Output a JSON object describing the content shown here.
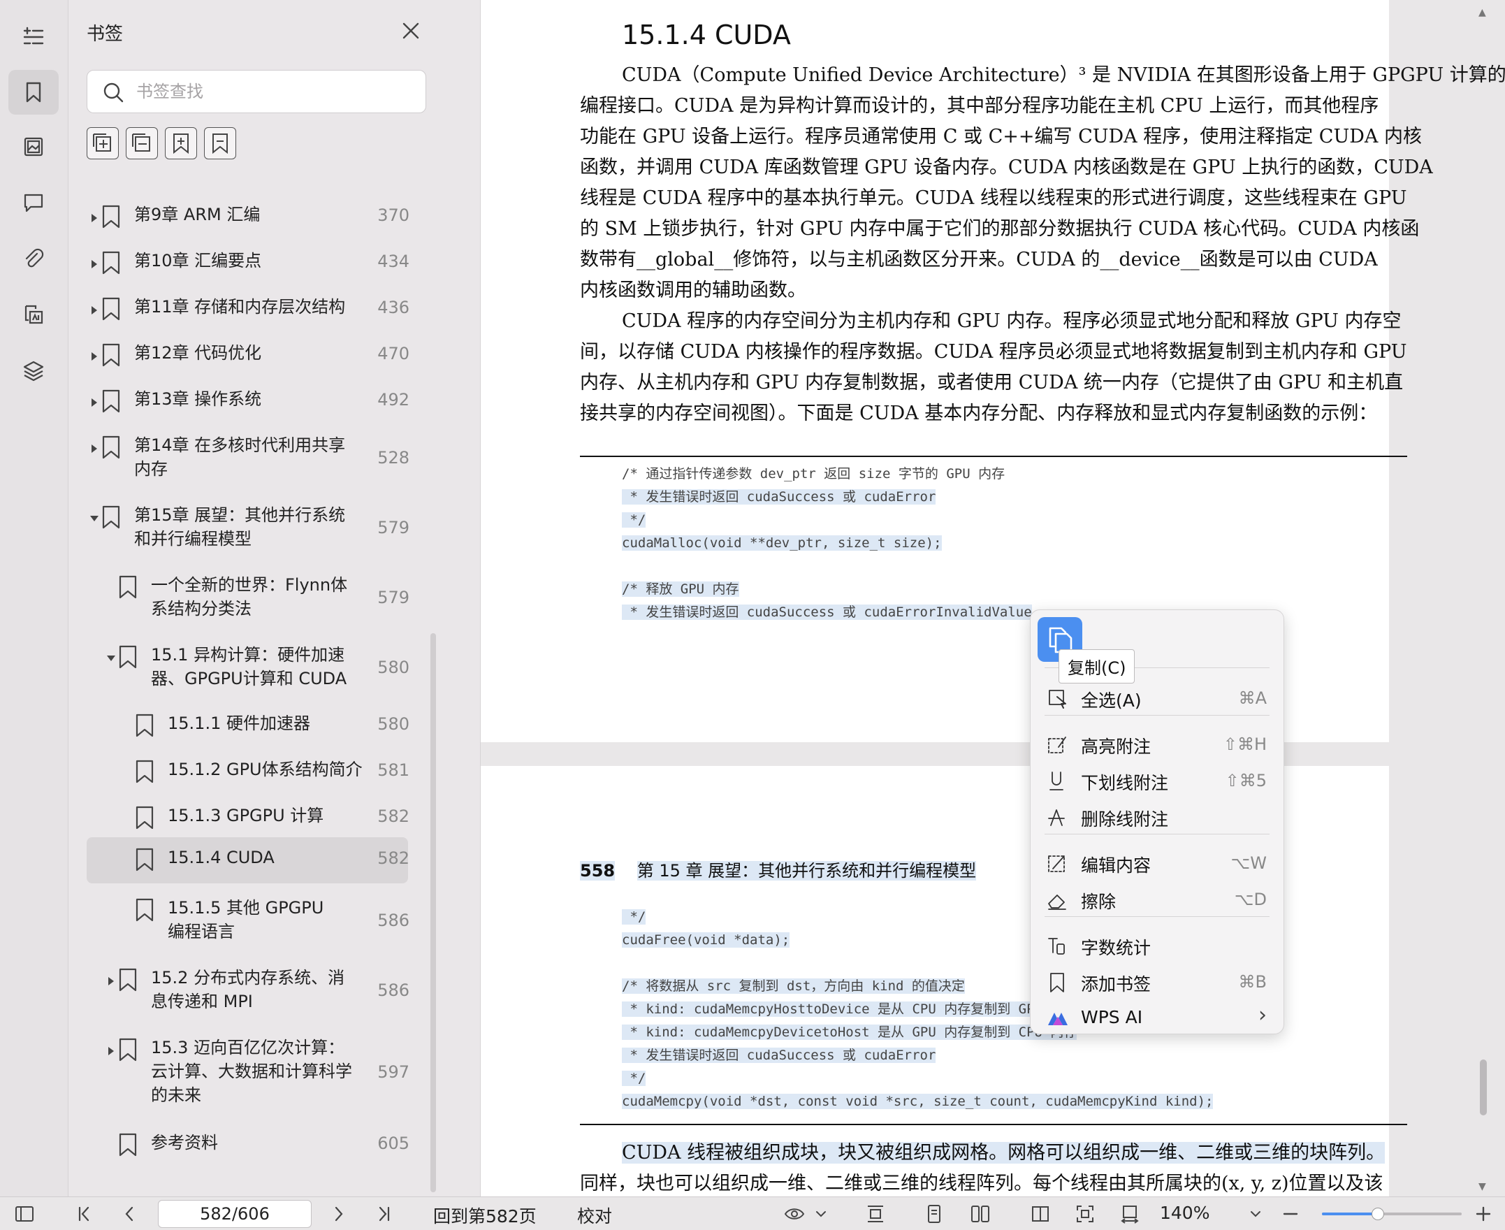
{
  "panel": {
    "title": "书签",
    "search_placeholder": "书签查找",
    "items": [
      {
        "label": "第9章  ARM 汇编",
        "page": "370"
      },
      {
        "label": "第10章  汇编要点",
        "page": "434"
      },
      {
        "label": "第11章  存储和内存层次结构",
        "page": "436"
      },
      {
        "label": "第12章  代码优化",
        "page": "470"
      },
      {
        "label": "第13章  操作系统",
        "page": "492"
      },
      {
        "label_lines": [
          "第14章  在多核时代利用共享",
          "内存"
        ],
        "page": "528"
      },
      {
        "label_lines": [
          "第15章  展望：其他并行系统",
          "和并行编程模型"
        ],
        "page": "579"
      },
      {
        "label_lines": [
          "一个全新的世界：Flynn体",
          "系结构分类法"
        ],
        "page": "579"
      },
      {
        "label_lines": [
          "15.1  异构计算：硬件加速",
          "器、GPGPU计算和 CUDA"
        ],
        "page": "580"
      },
      {
        "label": "15.1.1  硬件加速器",
        "page": "580"
      },
      {
        "label": "15.1.2  GPU体系结构简介",
        "page": "581"
      },
      {
        "label": "15.1.3    GPGPU 计算",
        "page": "582"
      },
      {
        "label": "15.1.4    CUDA",
        "page": "582"
      },
      {
        "label_lines": [
          "15.1.5    其他 GPGPU",
          "编程语言"
        ],
        "page": "586"
      },
      {
        "label_lines": [
          "15.2  分布式内存系统、消",
          "息传递和 MPI"
        ],
        "page": "586"
      },
      {
        "label_lines": [
          "15.3  迈向百亿亿次计算：",
          "云计算、大数据和计算科学",
          "的未来"
        ],
        "page": "597"
      },
      {
        "label": "参考资料",
        "page": "605"
      }
    ]
  },
  "doc": {
    "heading": "15.1.4    CUDA",
    "para1_lines": [
      "CUDA（Compute Unified Device Architecture）³ 是 NVIDIA 在其图形设备上用于 GPGPU 计算的",
      "编程接口。CUDA 是为异构计算而设计的，其中部分程序功能在主机 CPU 上运行，而其他程序",
      "功能在 GPU 设备上运行。程序员通常使用 C 或 C++编写 CUDA 程序，使用注释指定 CUDA 内核",
      "函数，并调用 CUDA 库函数管理 GPU 设备内存。CUDA 内核函数是在 GPU 上执行的函数，CUDA",
      "线程是 CUDA 程序中的基本执行单元。CUDA 线程以线程束的形式进行调度，这些线程束在 GPU",
      "的 SM 上锁步执行，针对 GPU 内存中属于它们的那部分数据执行 CUDA 核心代码。CUDA 内核函",
      "数带有__global__修饰符，以与主机函数区分开来。CUDA 的__device__函数是可以由 CUDA",
      "内核函数调用的辅助函数。"
    ],
    "para2_lines": [
      "CUDA 程序的内存空间分为主机内存和 GPU 内存。程序必须显式地分配和释放 GPU 内存空",
      "间，以存储 CUDA 内核操作的程序数据。CUDA 程序员必须显式地将数据复制到主机内存和 GPU",
      "内存、从主机内存和 GPU 内存复制数据，或者使用 CUDA 统一内存（它提供了由 GPU 和主机直",
      "接共享的内存空间视图）。下面是 CUDA 基本内存分配、内存释放和显式内存复制函数的示例："
    ],
    "code1": [
      "/* 通过指针传递参数 dev_ptr 返回 size 字节的 GPU 内存",
      " * 发生错误时返回 cudaSuccess 或 cudaError",
      " */",
      "cudaMalloc(void **dev_ptr, size_t size);",
      "",
      "/* 释放 GPU 内存",
      " * 发生错误时返回 cudaSuccess 或 cudaErrorInvalidValue"
    ],
    "page2_header_num": "558",
    "page2_header_text": "第 15 章   展望：其他并行系统和并行编程模型",
    "code2": [
      " */",
      "cudaFree(void *data);",
      "",
      "/* 将数据从 src 复制到 dst，方向由 kind 的值决定",
      " * kind: cudaMemcpyHosttoDevice 是从 CPU 内存复制到 GPU 内存",
      " * kind: cudaMemcpyDevicetoHost 是从 GPU 内存复制到 CPU 内存",
      " * 发生错误时返回 cudaSuccess 或 cudaError",
      " */",
      "cudaMemcpy(void *dst, const void *src, size_t count, cudaMemcpyKind kind);"
    ],
    "para3_line1": "CUDA 线程被组织成块，块又被组织成网格。网格可以组织成一维、二维或三维的块阵列。",
    "para3_line2": "同样，块也可以组织成一维、二维或三维的线程阵列。每个线程由其所属块的(x, y, z)位置以及该"
  },
  "context_menu": {
    "copy_tooltip": "复制(C)",
    "items": [
      {
        "label": "全选(A)",
        "key": "⌘A"
      },
      {
        "label": "高亮附注",
        "key": "⇧⌘H"
      },
      {
        "label": "下划线附注",
        "key": "⇧⌘5"
      },
      {
        "label": "删除线附注",
        "key": ""
      },
      {
        "label": "编辑内容",
        "key": "⌥W"
      },
      {
        "label": "擦除",
        "key": "⌥D"
      },
      {
        "label": "字数统计",
        "key": ""
      },
      {
        "label": "添加书签",
        "key": "⌘B"
      },
      {
        "label": "WPS AI",
        "key": "›"
      }
    ]
  },
  "statusbar": {
    "page_field": "582/606",
    "goto_label": "回到第582页",
    "proofread_label": "校对",
    "zoom_label": "140%",
    "zoom_fraction": 0.4
  },
  "colors": {
    "accent": "#4b8ff0",
    "selection": "#dde8f5"
  }
}
